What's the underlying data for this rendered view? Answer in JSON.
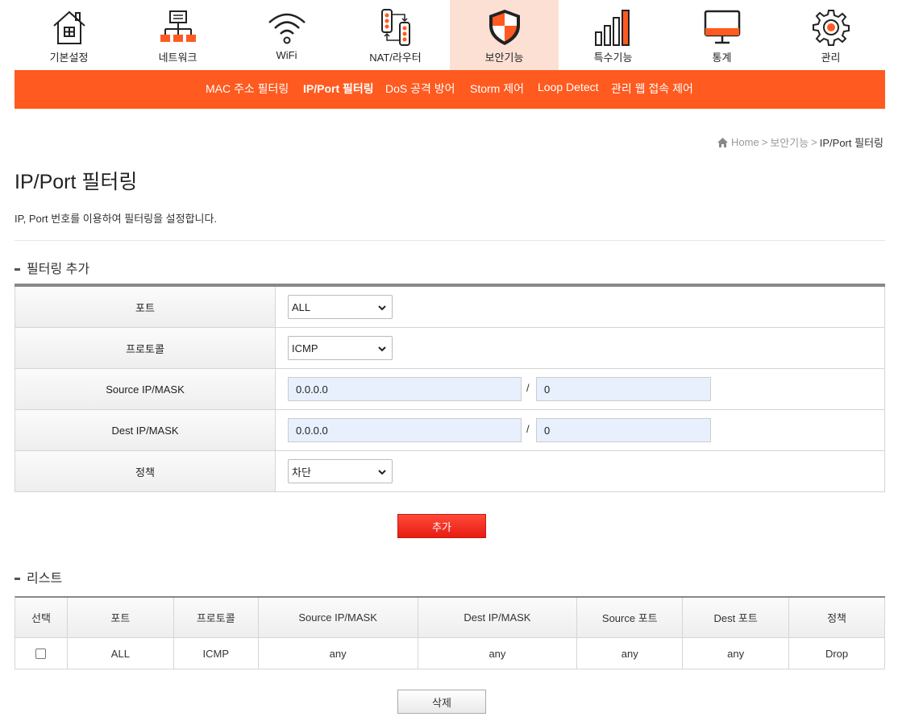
{
  "topnav": {
    "items": [
      {
        "label": "기본설정",
        "icon": "house-icon"
      },
      {
        "label": "네트워크",
        "icon": "network-icon"
      },
      {
        "label": "WiFi",
        "icon": "wifi-icon"
      },
      {
        "label": "NAT/라우터",
        "icon": "router-icon"
      },
      {
        "label": "보안기능",
        "icon": "shield-icon"
      },
      {
        "label": "특수기능",
        "icon": "bar-chart-icon"
      },
      {
        "label": "통계",
        "icon": "monitor-icon"
      },
      {
        "label": "관리",
        "icon": "gear-icon"
      }
    ],
    "active_index": 4
  },
  "subnav": {
    "items": [
      "MAC 주소 필터링",
      "IP/Port 필터링",
      "DoS 공격 방어",
      "Storm 제어",
      "Loop Detect",
      "관리 웹 접속 제어"
    ],
    "active_index": 1
  },
  "breadcrumb": {
    "home": "Home",
    "parent": "보안기능",
    "current": "IP/Port 필터링",
    "sep": ">"
  },
  "page": {
    "title": "IP/Port 필터링",
    "description": "IP, Port 번호를 이용하여 필터링을 설정합니다."
  },
  "add_section": {
    "title": "필터링 추가",
    "port_label": "포트",
    "port_value": "ALL",
    "protocol_label": "프로토콜",
    "protocol_value": "ICMP",
    "source_label": "Source IP/MASK",
    "source_ip": "0.0.0.0",
    "source_mask": "0",
    "dest_label": "Dest IP/MASK",
    "dest_ip": "0.0.0.0",
    "dest_mask": "0",
    "slash": "/",
    "policy_label": "정책",
    "policy_value": "차단",
    "add_button": "추가"
  },
  "list_section": {
    "title": "리스트",
    "columns": [
      "선택",
      "포트",
      "프로토콜",
      "Source IP/MASK",
      "Dest IP/MASK",
      "Source 포트",
      "Dest 포트",
      "정책"
    ],
    "rows": [
      {
        "port": "ALL",
        "protocol": "ICMP",
        "source_ip": "any",
        "dest_ip": "any",
        "source_port": "any",
        "dest_port": "any",
        "policy": "Drop",
        "checked": false
      }
    ],
    "delete_button": "삭제"
  },
  "colors": {
    "accent": "#ff5a1f",
    "active_tab_bg": "#fde0d4",
    "add_button": "#e81b12"
  }
}
